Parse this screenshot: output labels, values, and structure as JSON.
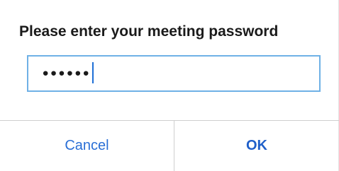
{
  "dialog": {
    "title": "Please enter your meeting password",
    "password_mask": "••••••",
    "cancel_label": "Cancel",
    "ok_label": "OK"
  },
  "colors": {
    "accent": "#1f5fc9",
    "input_border": "#6fb1e6",
    "divider": "#cfcfcf"
  }
}
